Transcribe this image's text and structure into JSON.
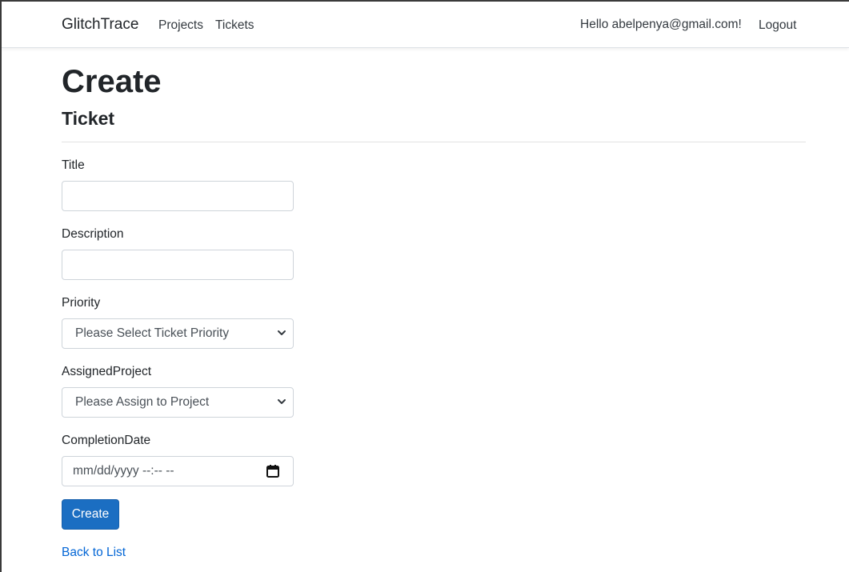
{
  "nav": {
    "brand": "GlitchTrace",
    "links": [
      "Projects",
      "Tickets"
    ],
    "greeting": "Hello abelpenya@gmail.com!",
    "logout": "Logout"
  },
  "page": {
    "title": "Create",
    "subtitle": "Ticket"
  },
  "form": {
    "title_label": "Title",
    "title_value": "",
    "description_label": "Description",
    "description_value": "",
    "priority_label": "Priority",
    "priority_selected": "Please Select Ticket Priority",
    "project_label": "AssignedProject",
    "project_selected": "Please Assign to Project",
    "completion_label": "CompletionDate",
    "completion_placeholder": "mm/dd/yyyy --:-- --",
    "submit_label": "Create"
  },
  "footer": {
    "back_link": "Back to List"
  },
  "icons": {
    "select_arrow": "chevron-down-icon",
    "date_picker": "calendar-icon"
  },
  "colors": {
    "primary": "#1b6ec2",
    "link": "#0366d6"
  }
}
